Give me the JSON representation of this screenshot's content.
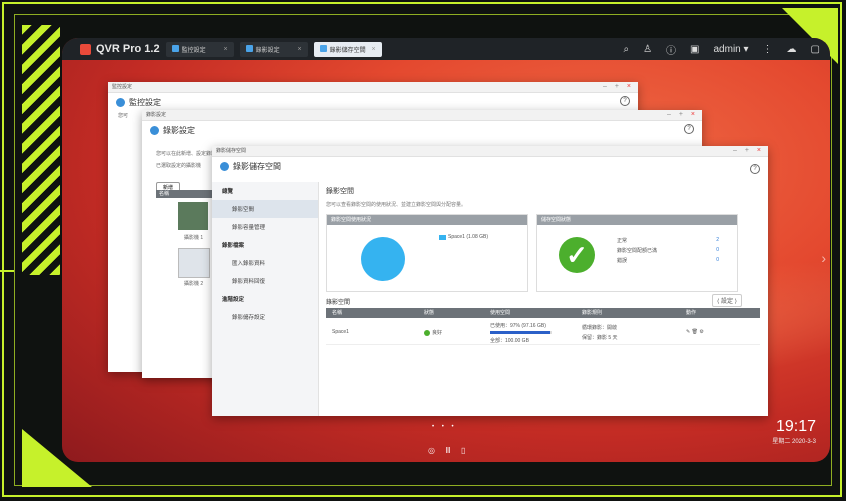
{
  "app": {
    "name": "QVR Pro 1.2"
  },
  "tabs": [
    {
      "label": "監控設定"
    },
    {
      "label": "錄影設定"
    },
    {
      "label": "錄影儲存空間"
    }
  ],
  "topbar": {
    "user": "admin ▾"
  },
  "windows": {
    "w1": {
      "titlebar": "監控設定",
      "heading": "監控設定",
      "note": "您可"
    },
    "w2": {
      "titlebar": "錄影設定",
      "heading": "錄影設定",
      "line1": "您可以在此新增、設定錄影排程",
      "line2": "已選取設定的攝影機",
      "btn_add": "新增",
      "col_name": "名稱",
      "cam1": "攝影機 1",
      "cam2": "攝影機 2"
    },
    "w3": {
      "titlebar": "錄影儲存空間",
      "heading": "錄影儲存空間",
      "sidebar": [
        {
          "label": "總覽",
          "kind": "grp"
        },
        {
          "label": "錄影空間",
          "kind": "sel"
        },
        {
          "label": "錄影容量管理",
          "kind": "sub"
        },
        {
          "label": "錄影檔案",
          "kind": "grp"
        },
        {
          "label": "匯入錄影資料",
          "kind": "sub"
        },
        {
          "label": "錄影資料回復",
          "kind": "sub"
        },
        {
          "label": "進階設定",
          "kind": "grp"
        },
        {
          "label": "錄影儲存設定",
          "kind": "sub"
        }
      ],
      "main_title": "錄影空間",
      "main_desc": "您可以查看錄影空間的使用狀況、並建立錄影空間與分配容量。",
      "panel1_title": "錄影空間使用狀況",
      "legend": "Space1 (1.08 GB)",
      "panel2_title": "儲存空間狀態",
      "stats": [
        {
          "label": "正常",
          "value": "2"
        },
        {
          "label": "錄影空間配額已滿",
          "value": "0"
        },
        {
          "label": "錯誤",
          "value": "0"
        }
      ],
      "space_title": "錄影空間",
      "space_ctrl": "⟨ 設定 ⟩",
      "table_headers": [
        "名稱",
        "狀態",
        "使用空間",
        "錄影規則",
        "動作"
      ],
      "row": {
        "name": "Space1",
        "status": "良好",
        "used": "已使用：97% (97.16 GB)",
        "total": "全部：100.00 GB",
        "rule1": "循環錄影：開啟",
        "rule2": "保留：錄影 5 天",
        "actions": "✎ 🗑 ⚙",
        "usage_fraction": 0.97
      }
    }
  },
  "clock": {
    "time": "19:17",
    "date": "星期二 2020-3-3"
  },
  "pager": "• • •",
  "dock": "◎ Ⅲ ▯",
  "colors": {
    "accent": "#c6f12b",
    "bar": "#2b60c8",
    "ok": "#4caf2d",
    "pie": "#35b3f0"
  }
}
